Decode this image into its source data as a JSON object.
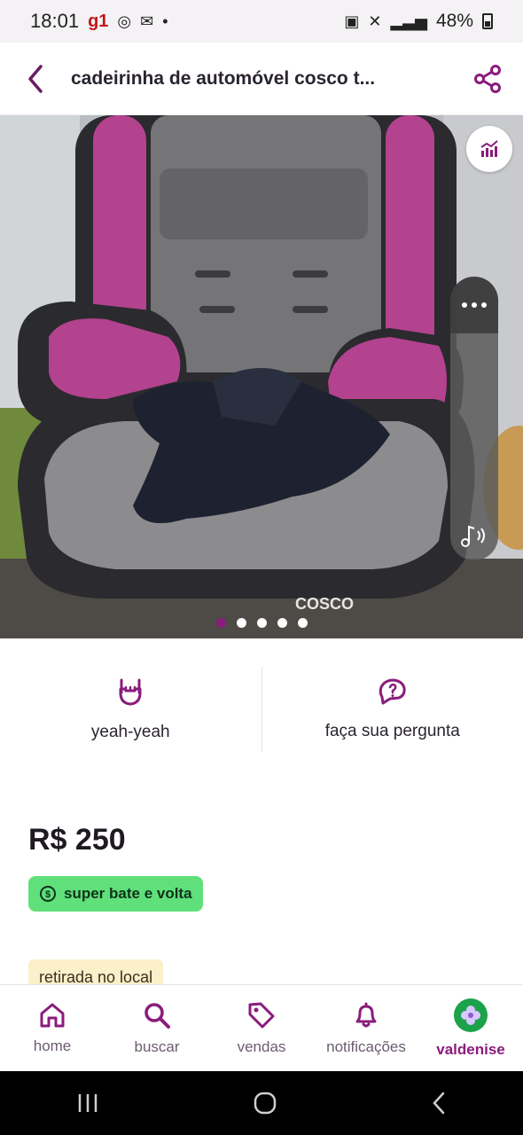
{
  "status_bar": {
    "time": "18:01",
    "g1": "g1",
    "battery": "48%"
  },
  "header": {
    "title": "cadeirinha de automóvel cosco t..."
  },
  "photo": {
    "brand_text": "COSCO",
    "carousel": {
      "count": 5,
      "active_index": 0
    }
  },
  "actions": [
    {
      "label": "yeah-yeah",
      "icon": "rock-hand-icon"
    },
    {
      "label": "faça sua pergunta",
      "icon": "question-bubble-icon"
    }
  ],
  "listing": {
    "price": "R$ 250",
    "badge_green": "super bate e volta",
    "badge_yellow": "retirada no local"
  },
  "bottom_nav": {
    "items": [
      {
        "label": "home",
        "icon": "home-icon"
      },
      {
        "label": "buscar",
        "icon": "search-icon"
      },
      {
        "label": "vendas",
        "icon": "tag-icon"
      },
      {
        "label": "notificações",
        "icon": "bell-icon"
      },
      {
        "label": "valdenise",
        "icon": "avatar",
        "active": true
      }
    ]
  },
  "colors": {
    "brand_purple": "#8a1c7c",
    "badge_green": "#5fe07a",
    "badge_yellow": "#fbf0c9"
  }
}
